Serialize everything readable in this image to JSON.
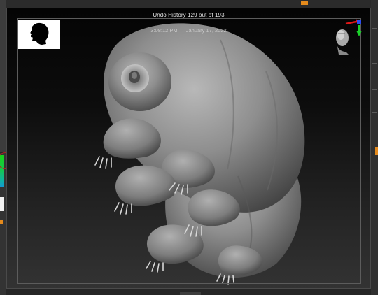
{
  "viewport": {
    "undo_history": "Undo History 129 out of 193",
    "time": "3:08:12 PM",
    "date": "January 17, 2022"
  },
  "icons": {
    "thumbnail": "head-silhouette-thumbnail-icon",
    "gizmo": "navigation-head-gizmo-icon"
  },
  "colors": {
    "accent_orange": "#e48a1c",
    "gizmo_red": "#e01818",
    "gizmo_green": "#1bd12a",
    "gizmo_blue": "#2b4df0",
    "model_clay": "#8f8f8f"
  }
}
